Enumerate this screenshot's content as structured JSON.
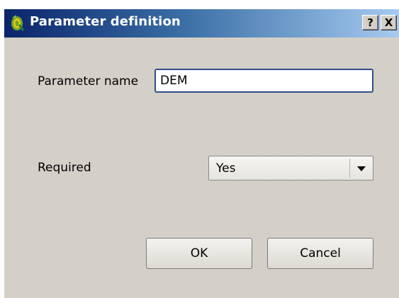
{
  "window": {
    "title": "Parameter definition",
    "help_label": "?",
    "close_label": "X",
    "app_icon": "qgis-logo-icon"
  },
  "form": {
    "parameter_name_label": "Parameter name",
    "parameter_name_value": "DEM",
    "required_label": "Required",
    "required_value": "Yes",
    "required_options": [
      "Yes"
    ]
  },
  "buttons": {
    "ok_label": "OK",
    "cancel_label": "Cancel"
  },
  "colors": {
    "titlebar_start": "#0a246a",
    "titlebar_end": "#a6caf0",
    "dialog_bg": "#d4d0c8",
    "input_border": "#2d4f8a"
  }
}
